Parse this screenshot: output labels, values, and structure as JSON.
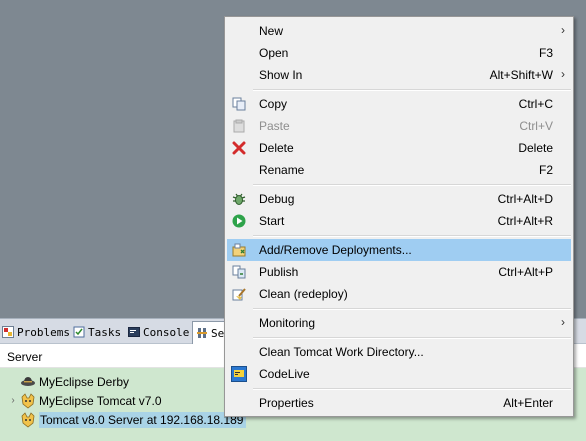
{
  "tabs": [
    {
      "label": "Problems",
      "icon": "problems-icon"
    },
    {
      "label": "Tasks",
      "icon": "tasks-icon"
    },
    {
      "label": "Console",
      "icon": "console-icon"
    },
    {
      "label": "Se",
      "icon": "servers-icon"
    }
  ],
  "servers_view": {
    "header": "Server",
    "servers": [
      {
        "label": "MyEclipse Derby",
        "icon": "derby-icon",
        "expandable": false
      },
      {
        "label": "MyEclipse Tomcat v7.0",
        "icon": "tomcat-icon",
        "expandable": true,
        "twisty": "›"
      },
      {
        "label": "Tomcat v8.0 Server at 192.168.18.189",
        "icon": "tomcat-icon",
        "expandable": false,
        "selected": true
      }
    ]
  },
  "context_menu": {
    "items": [
      {
        "label": "New",
        "shortcut": "",
        "submenu": true,
        "icon": ""
      },
      {
        "label": "Open",
        "shortcut": "F3",
        "icon": ""
      },
      {
        "label": "Show In",
        "shortcut": "Alt+Shift+W",
        "submenu": true,
        "icon": ""
      },
      {
        "label": "Copy",
        "shortcut": "Ctrl+C",
        "icon": "copy-icon"
      },
      {
        "label": "Paste",
        "shortcut": "Ctrl+V",
        "icon": "paste-icon",
        "disabled": true
      },
      {
        "label": "Delete",
        "shortcut": "Delete",
        "icon": "delete-icon"
      },
      {
        "label": "Rename",
        "shortcut": "F2",
        "icon": ""
      },
      {
        "label": "Debug",
        "shortcut": "Ctrl+Alt+D",
        "icon": "debug-icon"
      },
      {
        "label": "Start",
        "shortcut": "Ctrl+Alt+R",
        "icon": "start-icon"
      },
      {
        "label": "Add/Remove Deployments...",
        "shortcut": "",
        "icon": "deployments-icon",
        "highlighted": true
      },
      {
        "label": "Publish",
        "shortcut": "Ctrl+Alt+P",
        "icon": "publish-icon"
      },
      {
        "label": "Clean (redeploy)",
        "shortcut": "",
        "icon": "clean-icon"
      },
      {
        "label": "Monitoring",
        "shortcut": "",
        "submenu": true,
        "icon": ""
      },
      {
        "label": "Clean Tomcat Work Directory...",
        "shortcut": "",
        "icon": ""
      },
      {
        "label": "CodeLive",
        "shortcut": "",
        "icon": "codelive-icon"
      },
      {
        "label": "Properties",
        "shortcut": "Alt+Enter",
        "icon": ""
      }
    ],
    "submenu_arrow": "›"
  },
  "colors": {
    "editor_bg": "#7e8891",
    "menu_bg": "#f0f0f0",
    "highlight": "#9fcdf2",
    "tree_bg": "#cfe7cf",
    "selection": "#a9d3e6"
  }
}
